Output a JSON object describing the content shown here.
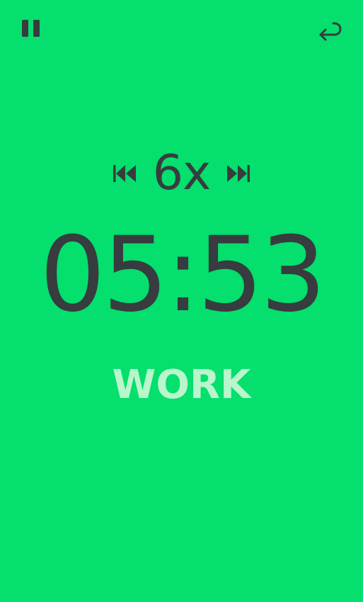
{
  "controls": {
    "pause_icon": "pause-icon",
    "back_icon": "return-arrow-icon",
    "prev_icon": "skip-previous-icon",
    "next_icon": "skip-next-icon"
  },
  "rounds": {
    "value": "6x"
  },
  "timer": {
    "value": "05:53"
  },
  "phase": {
    "label": "WORK",
    "color": "#b9f6cc"
  },
  "colors": {
    "background": "#04df6d",
    "foreground": "#373c3f"
  }
}
